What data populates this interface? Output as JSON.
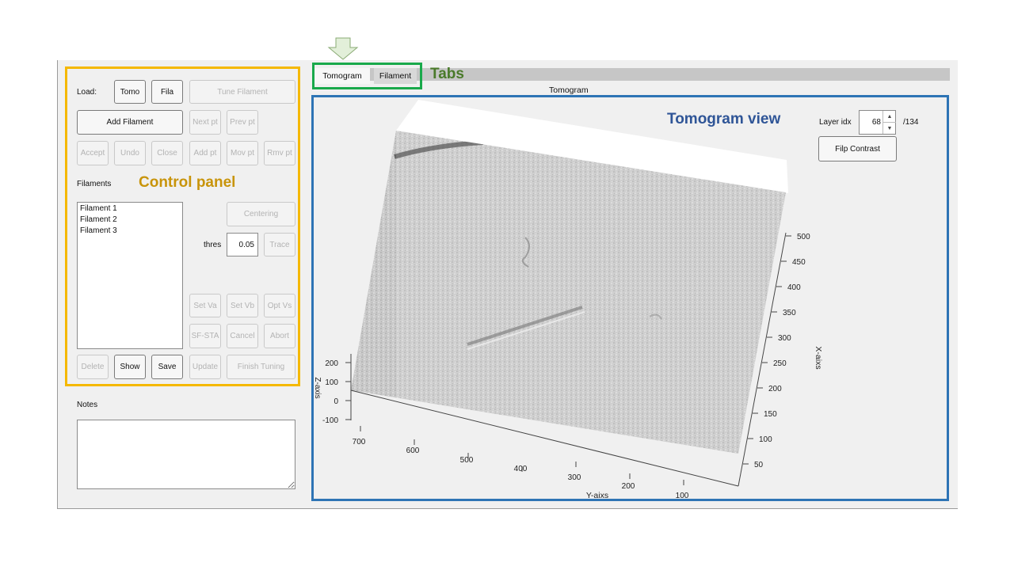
{
  "controls": {
    "load_label": "Load:",
    "tomo": "Tomo",
    "fila": "Fila",
    "tune_filament": "Tune Filament",
    "add_filament": "Add Filament",
    "next_pt": "Next pt",
    "prev_pt": "Prev pt",
    "accept": "Accept",
    "undo": "Undo",
    "close": "Close",
    "add_pt": "Add pt",
    "mov_pt": "Mov pt",
    "rmv_pt": "Rmv pt",
    "filaments_label": "Filaments",
    "filaments": [
      "Filament 1",
      "Filament 2",
      "Filament 3"
    ],
    "centering": "Centering",
    "thres_label": "thres",
    "thres_value": "0.05",
    "trace": "Trace",
    "set_va": "Set Va",
    "set_vb": "Set Vb",
    "opt_vs": "Opt Vs",
    "sf_sta": "SF-STA",
    "cancel": "Cancel",
    "abort": "Abort",
    "delete": "Delete",
    "show": "Show",
    "save": "Save",
    "update": "Update",
    "finish_tuning": "Finish Tuning",
    "notes_label": "Notes"
  },
  "tabs": {
    "tomogram": "Tomogram",
    "filament": "Filament"
  },
  "view": {
    "title": "Tomogram",
    "layer_label": "Layer idx",
    "layer_value": "68",
    "layer_total": "/134",
    "flip_contrast": "Filp Contrast",
    "axes": {
      "y_label": "Y-aixs",
      "x_label": "X-aixs",
      "z_label": "Z-axis",
      "y_ticks": [
        "700",
        "600",
        "500",
        "400",
        "300",
        "200",
        "100"
      ],
      "x_ticks": [
        "500",
        "450",
        "400",
        "350",
        "300",
        "250",
        "200",
        "150",
        "100",
        "50"
      ],
      "z_ticks": [
        "200",
        "100",
        "0",
        "-100"
      ]
    }
  },
  "annotations": {
    "control_panel": "Control panel",
    "tabs": "Tabs",
    "tomogram_view": "Tomogram view",
    "colors": {
      "yellow": "#f5b800",
      "green": "#19a94b",
      "blue": "#2e74b5"
    }
  }
}
